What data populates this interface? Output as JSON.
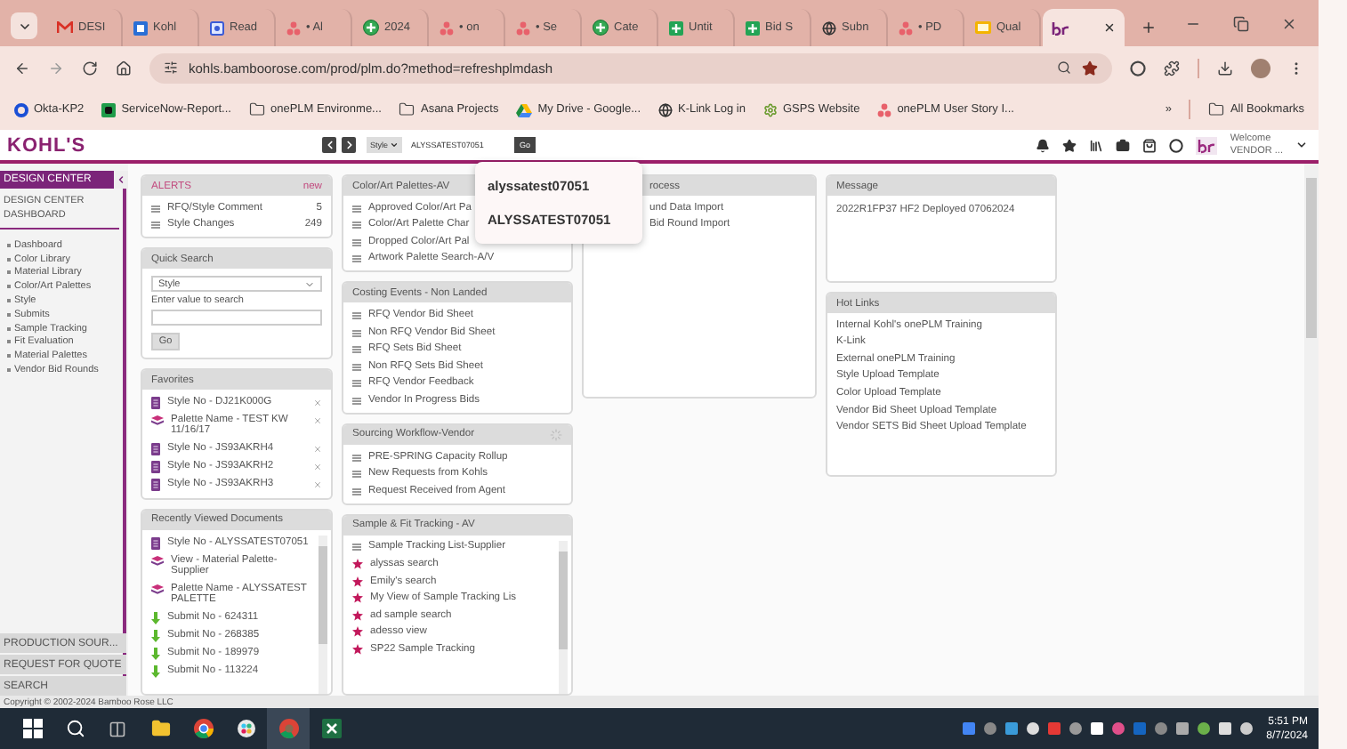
{
  "browser": {
    "tabs": [
      {
        "kind": "mail",
        "label": "DESI",
        "selected": false
      },
      {
        "kind": "doc",
        "label": "Kohl",
        "selected": false
      },
      {
        "kind": "reader",
        "label": "Read",
        "selected": false
      },
      {
        "kind": "dots",
        "label": "• Al",
        "selected": false
      },
      {
        "kind": "plus",
        "label": "2024",
        "selected": false
      },
      {
        "kind": "dots",
        "label": "• on",
        "selected": false
      },
      {
        "kind": "dots",
        "label": "• Se",
        "selected": false
      },
      {
        "kind": "plus",
        "label": "Cate",
        "selected": false
      },
      {
        "kind": "sheet",
        "label": "Untit",
        "selected": false
      },
      {
        "kind": "sheet",
        "label": "Bid S",
        "selected": false
      },
      {
        "kind": "globe",
        "label": "Subn",
        "selected": false
      },
      {
        "kind": "dots",
        "label": "• PD",
        "selected": false
      },
      {
        "kind": "note",
        "label": "Qual",
        "selected": false
      },
      {
        "kind": "logo",
        "selected": true
      }
    ],
    "address": "kohls.bamboorose.com/prod/plm.do?method=refreshplmdash",
    "bookmarks": [
      {
        "kind": "ring",
        "label": "Okta-KP2"
      },
      {
        "kind": "square",
        "label": "ServiceNow-Report..."
      },
      {
        "kind": "folder",
        "label": "onePLM Environme..."
      },
      {
        "kind": "folder",
        "label": "Asana Projects"
      },
      {
        "kind": "triangle",
        "label": "My Drive - Google..."
      },
      {
        "kind": "globe",
        "label": "K-Link Log in"
      },
      {
        "kind": "gear",
        "label": "GSPS Website"
      },
      {
        "kind": "dots",
        "label": "onePLM User Story I..."
      }
    ],
    "more": "»",
    "all_bookmarks": "All Bookmarks"
  },
  "app": {
    "logo": "KOHL'S",
    "search_type": "Style",
    "search_value": "ALYSSATEST07051",
    "go": "Go",
    "suggestions": [
      "alyssatest07051",
      "ALYSSATEST07051"
    ],
    "welcome": "Welcome",
    "user": "VENDOR ..."
  },
  "sidebar": {
    "title": "DESIGN CENTER",
    "section": "DESIGN CENTER DASHBOARD",
    "items": [
      "Dashboard",
      "Color Library",
      "Material Library",
      "Color/Art Palettes",
      "Style",
      "Submits",
      "Sample Tracking",
      "Fit Evaluation",
      "Material Palettes",
      "Vendor Bid Rounds"
    ],
    "bottom": [
      "PRODUCTION SOUR...",
      "REQUEST FOR QUOTE",
      "SEARCH"
    ]
  },
  "columns": [
    [
      {
        "kind": "alerts",
        "title": "ALERTS",
        "badge": "new",
        "items": [
          {
            "kind": "link",
            "label": "RFQ/Style Comment",
            "count": "5"
          },
          {
            "kind": "link",
            "label": "Style Changes",
            "count": "249"
          }
        ]
      },
      {
        "kind": "search",
        "title": "Quick Search",
        "select": "Style",
        "field_label": "Enter value to search",
        "button": "Go"
      },
      {
        "kind": "list",
        "title": "Favorites",
        "removable": true,
        "items": [
          {
            "kind": "style",
            "label": "Style No - DJ21K000G"
          },
          {
            "kind": "palette",
            "label": "Palette Name - TEST KW 11/16/17"
          },
          {
            "kind": "style",
            "label": "Style No - JS93AKRH4"
          },
          {
            "kind": "style",
            "label": "Style No - JS93AKRH2"
          },
          {
            "kind": "style",
            "label": "Style No - JS93AKRH3"
          }
        ]
      },
      {
        "kind": "list",
        "title": "Recently Viewed Documents",
        "scrollbar": true,
        "items": [
          {
            "kind": "style",
            "label": "Style No - ALYSSATEST07051"
          },
          {
            "kind": "palette",
            "label": "View - Material Palette-Supplier"
          },
          {
            "kind": "palette",
            "label": "Palette Name - ALYSSATEST PALETTE"
          },
          {
            "kind": "submit",
            "label": "Submit No - 624311"
          },
          {
            "kind": "submit",
            "label": "Submit No - 268385"
          },
          {
            "kind": "submit",
            "label": "Submit No - 189979"
          },
          {
            "kind": "submit",
            "label": "Submit No - 113224"
          }
        ]
      }
    ],
    [
      {
        "kind": "list",
        "title": "Color/Art Palettes-AV",
        "items": [
          {
            "kind": "link",
            "label": "Approved Color/Art Pa"
          },
          {
            "kind": "link",
            "label": "Color/Art Palette Char"
          },
          {
            "kind": "link",
            "label": "Dropped Color/Art Pal"
          },
          {
            "kind": "link",
            "label": "Artwork Palette Search-A/V"
          }
        ]
      },
      {
        "kind": "list",
        "title": "Costing Events - Non Landed",
        "items": [
          {
            "kind": "link",
            "label": "RFQ Vendor Bid Sheet"
          },
          {
            "kind": "link",
            "label": "Non RFQ Vendor Bid Sheet"
          },
          {
            "kind": "link",
            "label": "RFQ Sets Bid Sheet"
          },
          {
            "kind": "link",
            "label": "Non RFQ Sets Bid Sheet"
          },
          {
            "kind": "link",
            "label": "RFQ Vendor Feedback"
          },
          {
            "kind": "link",
            "label": "Vendor In Progress Bids"
          }
        ]
      },
      {
        "kind": "list",
        "title": "Sourcing Workflow-Vendor",
        "loading": true,
        "items": [
          {
            "kind": "link",
            "label": "PRE-SPRING Capacity Rollup"
          },
          {
            "kind": "link",
            "label": "New Requests from Kohls"
          },
          {
            "kind": "link",
            "label": "Request Received from Agent"
          }
        ]
      },
      {
        "kind": "list",
        "title": "Sample & Fit Tracking - AV",
        "scrollbar": true,
        "items": [
          {
            "kind": "link",
            "label": "Sample Tracking List-Supplier"
          },
          {
            "kind": "saved",
            "label": "alyssas search"
          },
          {
            "kind": "saved",
            "label": "Emily's search"
          },
          {
            "kind": "saved",
            "label": "My View of Sample Tracking Lis"
          },
          {
            "kind": "saved",
            "label": "ad sample search"
          },
          {
            "kind": "saved",
            "label": "adesso view"
          },
          {
            "kind": "saved",
            "label": "SP22 Sample Tracking"
          }
        ]
      }
    ],
    [
      {
        "kind": "list",
        "title": "rocess",
        "items": [
          {
            "kind": "text",
            "label": "und Data Import"
          },
          {
            "kind": "text",
            "label": "Bid Round Import"
          }
        ]
      }
    ],
    [
      {
        "kind": "message",
        "title": "Message",
        "text": "2022R1FP37 HF2 Deployed 07062024"
      },
      {
        "kind": "list",
        "title": "Hot Links",
        "items": [
          {
            "kind": "text",
            "label": "Internal Kohl's onePLM Training"
          },
          {
            "kind": "text",
            "label": "K-Link"
          },
          {
            "kind": "text",
            "label": "External onePLM Training"
          },
          {
            "kind": "text",
            "label": "Style Upload Template"
          },
          {
            "kind": "text",
            "label": "Color Upload Template"
          },
          {
            "kind": "text",
            "label": "Vendor Bid Sheet Upload Template"
          },
          {
            "kind": "text",
            "label": "Vendor SETS Bid Sheet Upload Template"
          }
        ]
      }
    ]
  ],
  "footer": "Copyright © 2002-2024 Bamboo Rose LLC",
  "taskbar": {
    "time": "5:51 PM",
    "date": "8/7/2024"
  }
}
